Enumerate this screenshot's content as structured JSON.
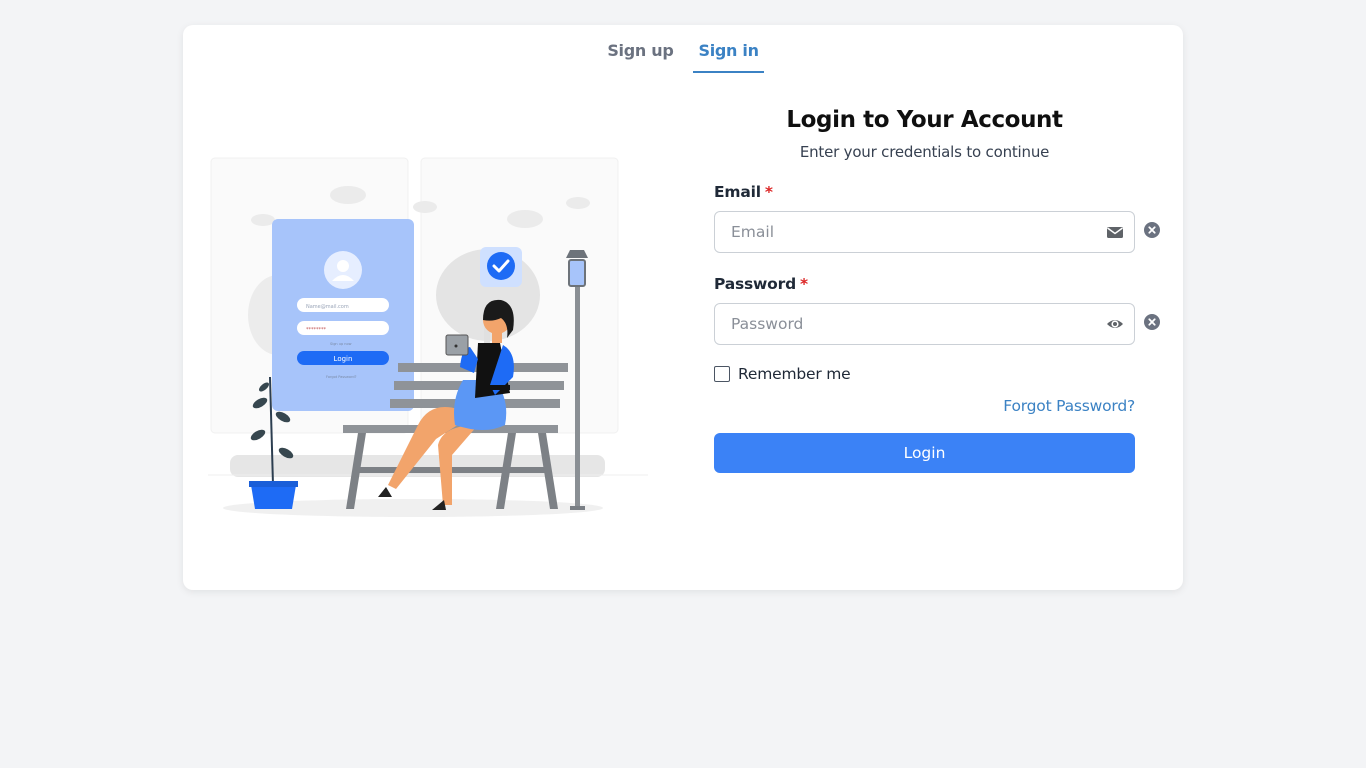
{
  "tabs": {
    "signup": "Sign up",
    "signin": "Sign in",
    "active": "signin"
  },
  "form": {
    "title": "Login to Your Account",
    "subtitle": "Enter your credentials to continue",
    "email_label": "Email",
    "email_placeholder": "Email",
    "email_value": "",
    "password_label": "Password",
    "password_placeholder": "Password",
    "password_value": "",
    "required_mark": "*",
    "remember_label": "Remember me",
    "remember_checked": false,
    "forgot_label": "Forgot Password?",
    "login_button": "Login"
  },
  "illustration": {
    "mini_email": "Name@mail.com",
    "mini_password": "********",
    "mini_login": "Login",
    "mini_signup": "Sign up now",
    "mini_forgot": "Forgot Password?"
  },
  "icons": {
    "email": "envelope-icon",
    "password": "eye-icon",
    "clear": "clear-circle-icon"
  },
  "colors": {
    "accent": "#3b82f6",
    "link": "#3b82c4",
    "required": "#dc2626",
    "background": "#f3f4f6"
  }
}
